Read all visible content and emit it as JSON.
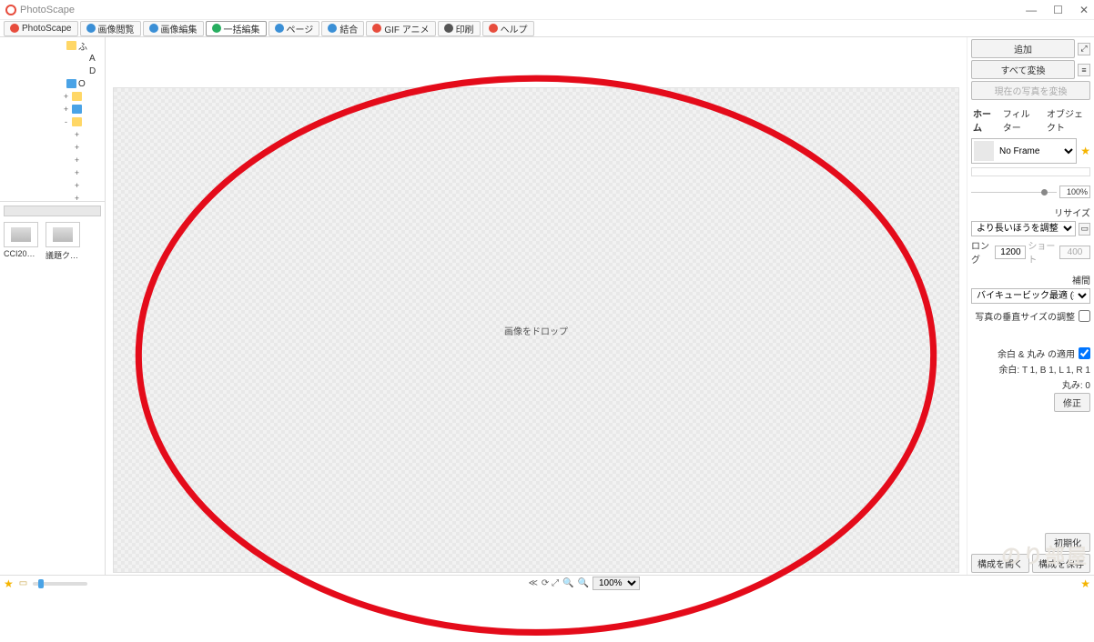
{
  "titlebar": {
    "title": "PhotoScape"
  },
  "toolbar": {
    "items": [
      {
        "label": "PhotoScape",
        "color": "#e74c3c"
      },
      {
        "label": "画像閲覧",
        "color": "#3a8fd6"
      },
      {
        "label": "画像編集",
        "color": "#3a8fd6"
      },
      {
        "label": "一括編集",
        "color": "#27ae60",
        "active": true
      },
      {
        "label": "ページ",
        "color": "#3a8fd6"
      },
      {
        "label": "結合",
        "color": "#3a8fd6"
      },
      {
        "label": "GIF アニメ",
        "color": "#e74c3c"
      },
      {
        "label": "印刷",
        "color": "#555"
      },
      {
        "label": "ヘルプ",
        "color": "#e74c3c"
      }
    ]
  },
  "tree": {
    "rows": [
      {
        "indent": 60,
        "exp": "",
        "icon": "fold-yellow",
        "label": "ふ"
      },
      {
        "indent": 72,
        "exp": "",
        "icon": "",
        "label": "A"
      },
      {
        "indent": 72,
        "exp": "",
        "icon": "",
        "label": "D"
      },
      {
        "indent": 60,
        "exp": "",
        "icon": "fold-blue",
        "label": "O"
      },
      {
        "indent": 66,
        "exp": "+",
        "icon": "fold-yellow",
        "label": ""
      },
      {
        "indent": 66,
        "exp": "+",
        "icon": "fold-blue",
        "label": ""
      },
      {
        "indent": 66,
        "exp": "-",
        "icon": "fold-yellow",
        "label": ""
      },
      {
        "indent": 78,
        "exp": "+",
        "icon": "",
        "label": ""
      },
      {
        "indent": 78,
        "exp": "+",
        "icon": "",
        "label": ""
      },
      {
        "indent": 78,
        "exp": "+",
        "icon": "",
        "label": ""
      },
      {
        "indent": 78,
        "exp": "+",
        "icon": "",
        "label": ""
      },
      {
        "indent": 78,
        "exp": "+",
        "icon": "",
        "label": ""
      },
      {
        "indent": 78,
        "exp": "+",
        "icon": "",
        "label": ""
      }
    ]
  },
  "thumbs": {
    "items": [
      {
        "caption": "CCI20…"
      },
      {
        "caption": "議題ク…"
      }
    ]
  },
  "canvas": {
    "drop_text": "画像をドロップ"
  },
  "right": {
    "add": "追加",
    "convert_all": "すべて変換",
    "convert_current": "現在の写真を変換",
    "tabs": {
      "home": "ホーム",
      "filter": "フィルター",
      "object": "オブジェクト"
    },
    "frame": {
      "label": "No Frame"
    },
    "zoom_pct": "100%",
    "resize": {
      "title": "リサイズ",
      "mode": "より長いほうを調整",
      "long_label": "ロング",
      "long_val": "1200",
      "short_label": "ショート",
      "short_val": "400"
    },
    "interp": {
      "title": "補間",
      "method": "バイキュービック最適 (推"
    },
    "vert_label": "写真の垂直サイズの調整",
    "margin": {
      "apply_label": "余白 & 丸み の適用",
      "values": "余白: T 1, B 1, L 1, R 1",
      "round": "丸み: 0",
      "edit": "修正"
    },
    "bottom": {
      "init": "初期化",
      "open_cfg": "構成を開く",
      "save_cfg": "構成を保存"
    }
  },
  "status": {
    "zoom_label": "100%"
  },
  "watermark": "のり部屋"
}
